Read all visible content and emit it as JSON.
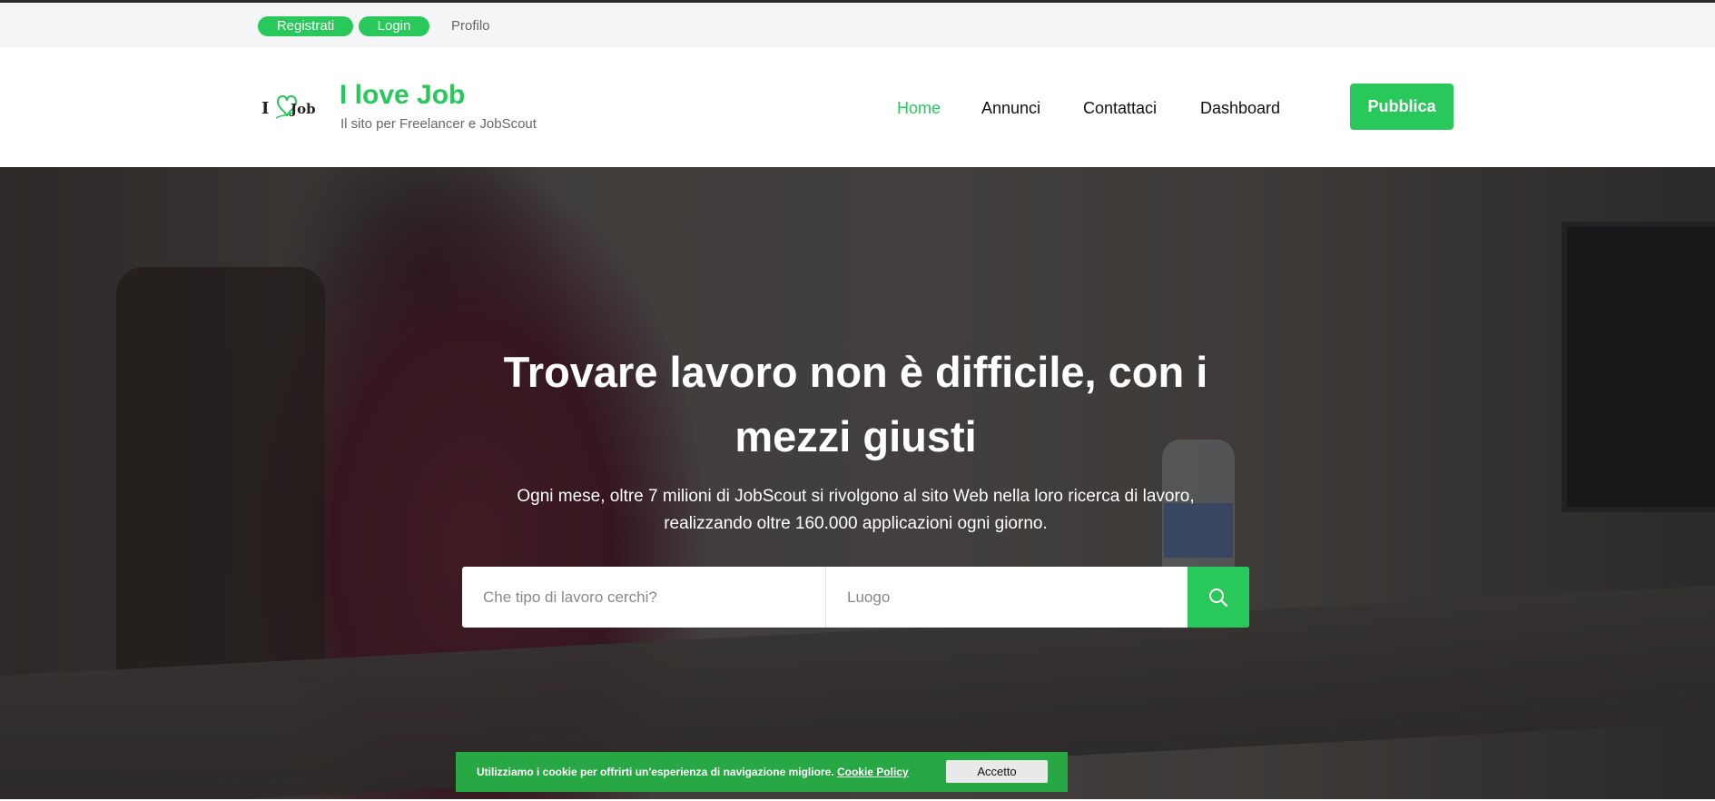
{
  "topbar": {
    "register_label": "Registrati",
    "login_label": "Login",
    "profile_label": "Profilo"
  },
  "header": {
    "logo_text_left": "I",
    "logo_text_right": "Job",
    "brand_title": "I love Job",
    "tagline": "Il sito per Freelancer e JobScout",
    "nav": {
      "home": "Home",
      "annunci": "Annunci",
      "contattaci": "Contattaci",
      "dashboard": "Dashboard"
    },
    "publish_label": "Pubblica"
  },
  "hero": {
    "title": "Trovare lavoro non è difficile, con i mezzi giusti",
    "subtitle": "Ogni mese, oltre 7 milioni di JobScout si rivolgono al sito Web nella loro ricerca di lavoro, realizzando oltre 160.000 applicazioni ogni giorno."
  },
  "search": {
    "job_placeholder": "Che tipo di lavoro cerchi?",
    "location_placeholder": "Luogo",
    "button_icon": "search-icon"
  },
  "cookie": {
    "text": "Utilizziamo i cookie per offrirti un'esperienza di navigazione migliore.",
    "link": "Cookie Policy",
    "accept_label": "Accetto"
  },
  "colors": {
    "accent": "#28c85a",
    "cookie_bg": "#28a745",
    "topbar_bg": "#f4f5f7"
  }
}
